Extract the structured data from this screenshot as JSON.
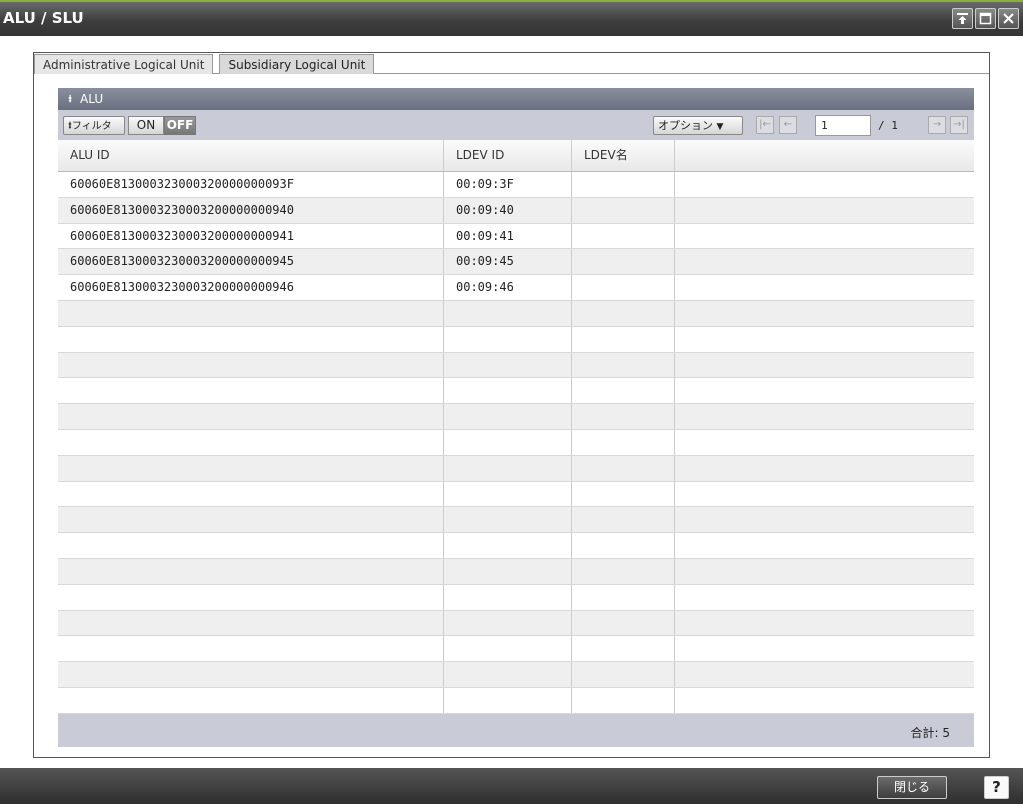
{
  "window": {
    "title": "ALU / SLU",
    "pin_icon": "pin-icon",
    "maximize_icon": "maximize-icon",
    "close_icon": "close-icon"
  },
  "tabs": [
    {
      "label": "Administrative Logical Unit",
      "active": true
    },
    {
      "label": "Subsidiary Logical Unit",
      "active": false
    }
  ],
  "section": {
    "title": "ALU",
    "collapse_icon": "double-chevron-up-icon"
  },
  "toolbar": {
    "filter_label": "フィルタ",
    "toggle_on": "ON",
    "toggle_off": "OFF",
    "options_label": "オプション",
    "page_current": "1",
    "page_total": "/ 1"
  },
  "table": {
    "headers": [
      "ALU ID",
      "LDEV ID",
      "LDEV名",
      ""
    ],
    "rows": [
      [
        "60060E813000323000320000000093F",
        "00:09:3F",
        "",
        ""
      ],
      [
        "60060E8130003230003200000000940",
        "00:09:40",
        "",
        ""
      ],
      [
        "60060E8130003230003200000000941",
        "00:09:41",
        "",
        ""
      ],
      [
        "60060E8130003230003200000000945",
        "00:09:45",
        "",
        ""
      ],
      [
        "60060E8130003230003200000000946",
        "00:09:46",
        "",
        ""
      ],
      [
        "",
        "",
        "",
        ""
      ],
      [
        "",
        "",
        "",
        ""
      ],
      [
        "",
        "",
        "",
        ""
      ],
      [
        "",
        "",
        "",
        ""
      ],
      [
        "",
        "",
        "",
        ""
      ],
      [
        "",
        "",
        "",
        ""
      ],
      [
        "",
        "",
        "",
        ""
      ],
      [
        "",
        "",
        "",
        ""
      ],
      [
        "",
        "",
        "",
        ""
      ],
      [
        "",
        "",
        "",
        ""
      ],
      [
        "",
        "",
        "",
        ""
      ],
      [
        "",
        "",
        "",
        ""
      ],
      [
        "",
        "",
        "",
        ""
      ],
      [
        "",
        "",
        "",
        ""
      ],
      [
        "",
        "",
        "",
        ""
      ],
      [
        "",
        "",
        "",
        ""
      ],
      [
        "",
        "",
        "",
        ""
      ]
    ]
  },
  "footer": {
    "total": "合計: 5"
  },
  "bottom": {
    "close_label": "閉じる",
    "help_label": "?"
  }
}
